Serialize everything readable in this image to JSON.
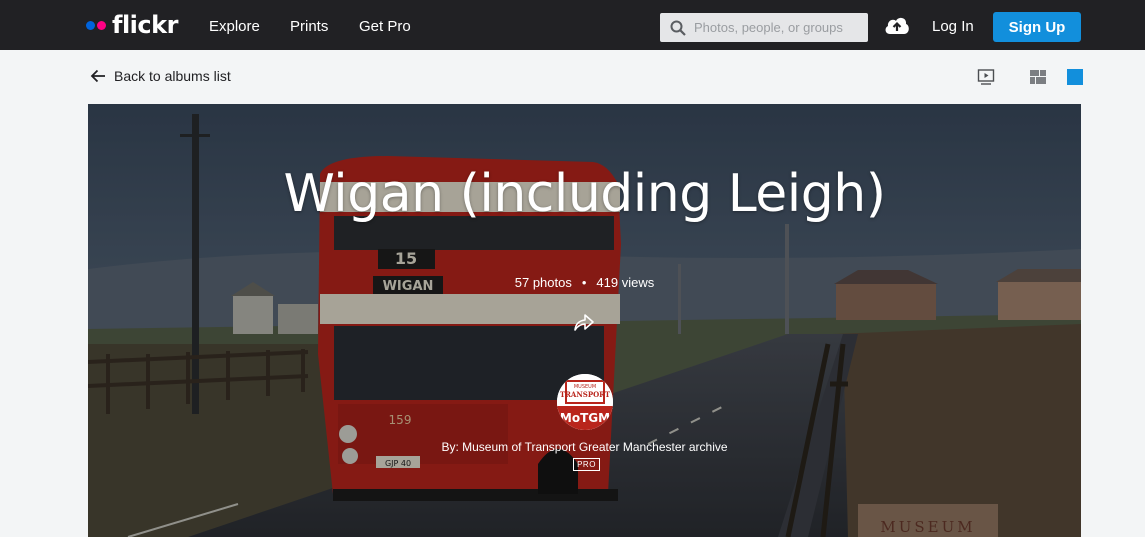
{
  "brand": {
    "name": "flickr",
    "dot_colors": [
      "#0063dc",
      "#ff0084"
    ]
  },
  "nav": {
    "explore": "Explore",
    "prints": "Prints",
    "get_pro": "Get Pro"
  },
  "search": {
    "placeholder": "Photos, people, or groups",
    "value": ""
  },
  "auth": {
    "login": "Log In",
    "signup": "Sign Up"
  },
  "subbar": {
    "back_label": "Back to albums list"
  },
  "album": {
    "title": "Wigan (including Leigh)",
    "photos": "57 photos",
    "separator": "•",
    "views": "419 views",
    "owner_byline": "By: Museum of Transport Greater Manchester archive",
    "pro_badge": "PRO"
  },
  "avatar_logo": {
    "line1": "MUSEUM",
    "line2": "TRANSPORT",
    "line3": "MoTGM"
  },
  "photo_text": {
    "route_number": "15",
    "destination": "WIGAN",
    "fleet_number": "159",
    "plate": "GJP 40",
    "sign": "MUSEUM"
  },
  "colors": {
    "accent": "#128fdc",
    "topbar": "#212124",
    "bus_red": "#b9251c",
    "active_view": "#128fdc"
  }
}
